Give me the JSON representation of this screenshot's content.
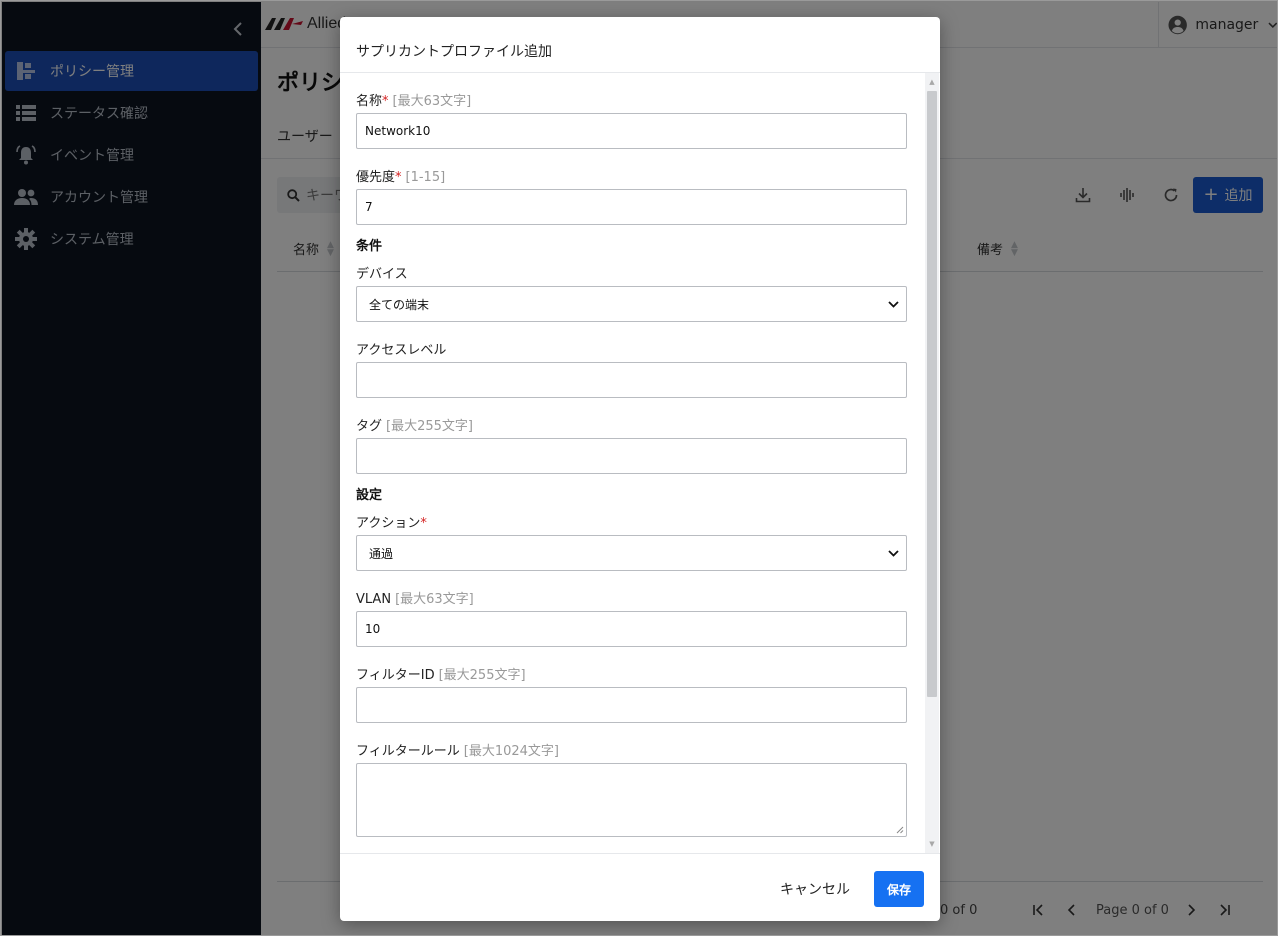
{
  "app": {
    "brand": "Allied",
    "user": "manager"
  },
  "sidebar": {
    "items": [
      {
        "label": "ポリシー管理",
        "icon": "policy-tree-icon"
      },
      {
        "label": "ステータス確認",
        "icon": "list-icon"
      },
      {
        "label": "イベント管理",
        "icon": "bell-icon"
      },
      {
        "label": "アカウント管理",
        "icon": "people-icon"
      },
      {
        "label": "システム管理",
        "icon": "gear-icon"
      }
    ]
  },
  "main": {
    "title": "ポリシ",
    "tab": "ユーザー",
    "search_placeholder": "キーワ",
    "add_label": "追加",
    "columns": {
      "name": "名称",
      "note": "備考"
    },
    "pager": {
      "count": "0 of 0",
      "page": "Page 0 of 0"
    }
  },
  "modal": {
    "title": "サプリカントプロファイル追加",
    "fields": {
      "name": {
        "label": "名称",
        "required": "*",
        "hint": "[最大63文字]",
        "value": "Network10"
      },
      "priority": {
        "label": "優先度",
        "required": "*",
        "hint": "[1-15]",
        "value": "7"
      },
      "conditions_heading": "条件",
      "device": {
        "label": "デバイス",
        "value": "全ての端末"
      },
      "access_level": {
        "label": "アクセスレベル",
        "value": ""
      },
      "tag": {
        "label": "タグ",
        "hint": "[最大255文字]",
        "value": ""
      },
      "settings_heading": "設定",
      "action": {
        "label": "アクション",
        "required": "*",
        "value": "通過"
      },
      "vlan": {
        "label": "VLAN",
        "hint": "[最大63文字]",
        "value": "10"
      },
      "filter_id": {
        "label": "フィルターID",
        "hint": "[最大255文字]",
        "value": ""
      },
      "filter_rule": {
        "label": "フィルタールール",
        "hint": "[最大1024文字]",
        "value": ""
      }
    },
    "cancel_label": "キャンセル",
    "save_label": "保存"
  },
  "colors": {
    "sidebar_bg": "#0d1421",
    "active_item": "#1c4fb9",
    "primary": "#1671f2",
    "required": "#d42121"
  }
}
